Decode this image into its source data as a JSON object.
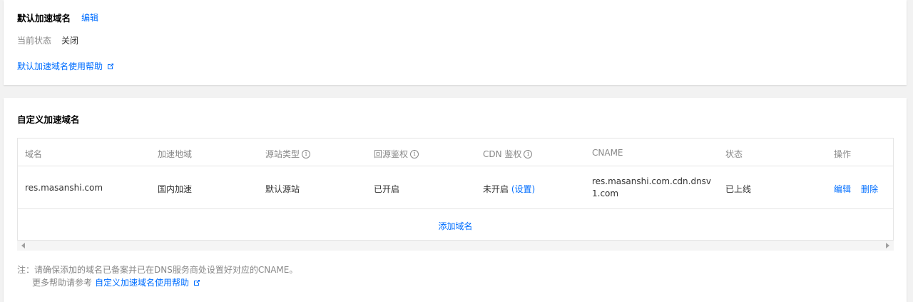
{
  "default_domain": {
    "title": "默认加速域名",
    "edit_label": "编辑",
    "state_label": "当前状态",
    "state_value": "关闭",
    "help_link": "默认加速域名使用帮助"
  },
  "custom_domain": {
    "title": "自定义加速域名",
    "columns": [
      "域名",
      "加速地域",
      "源站类型",
      "回源鉴权",
      "CDN 鉴权",
      "CNAME",
      "状态",
      "操作"
    ],
    "rows": [
      {
        "domain": "res.masanshi.com",
        "region": "国内加速",
        "origin_type": "默认源站",
        "back_auth": "已开启",
        "cdn_auth": "未开启",
        "cdn_auth_link": "(设置)",
        "cname": "res.masanshi.com.cdn.dnsv1.com",
        "status": "已上线",
        "action_edit": "编辑",
        "action_delete": "删除"
      }
    ],
    "add_label": "添加域名",
    "note_line1": "注：请确保添加的域名已备案并已在DNS服务商处设置好对应的CNAME。",
    "note_line2": "更多帮助请参考",
    "note_link": "自定义加速域名使用帮助"
  },
  "colors": {
    "link": "#006eff",
    "muted": "#888888",
    "border": "#e5e5e5"
  },
  "icons": {
    "external": "external-link-icon",
    "info": "info-icon"
  }
}
